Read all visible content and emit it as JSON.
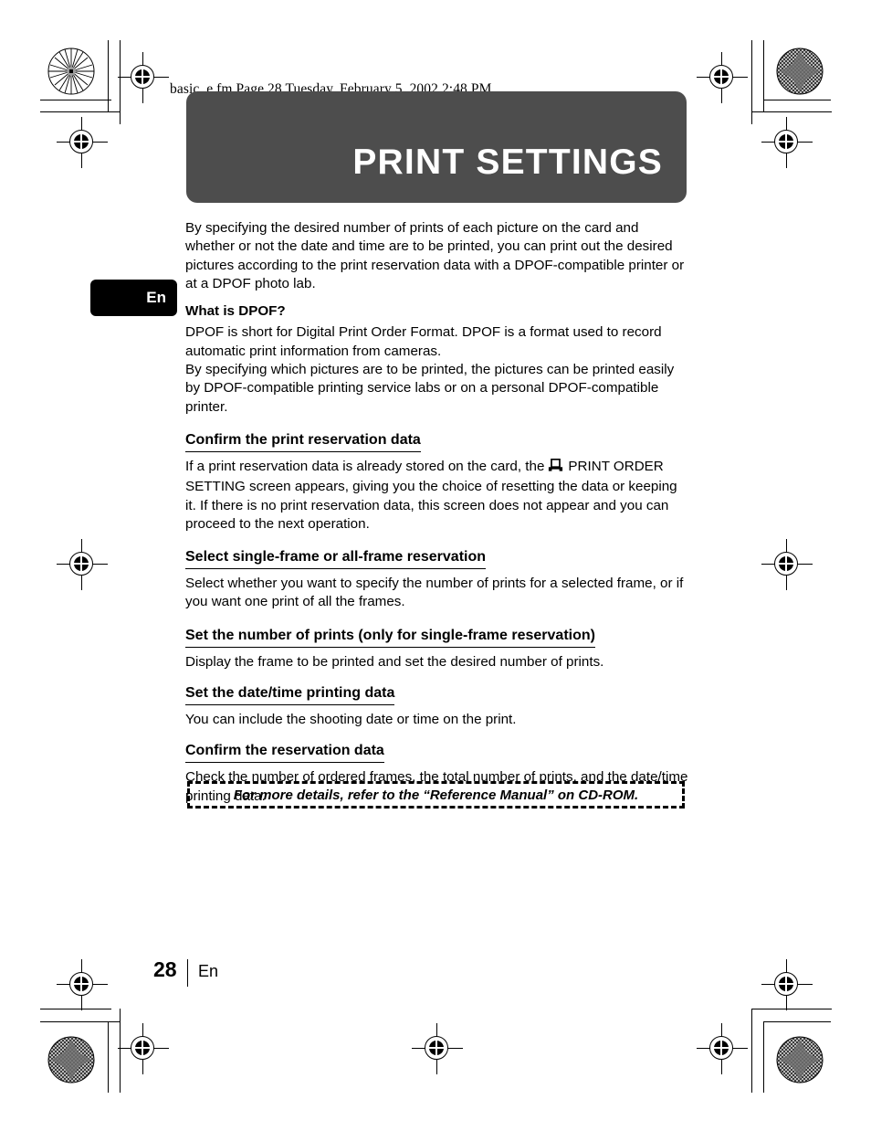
{
  "file_header": "basic_e.fm  Page 28  Tuesday, February 5, 2002  2:48 PM",
  "banner": {
    "title": "PRINT SETTINGS",
    "background_color": "#4d4d4d",
    "text_color": "#ffffff"
  },
  "language_tab": {
    "label": "En",
    "background_color": "#000000",
    "text_color": "#ffffff"
  },
  "content": {
    "intro": "By specifying the desired number of prints of each picture on the card and whether or not the date and time are to be printed, you can print out the desired pictures according to the print reservation data with a DPOF-compatible printer or at a DPOF photo lab.",
    "dpof_subhead": "What is DPOF?",
    "dpof_para_1": "DPOF is short for Digital Print Order Format. DPOF is a format used to record automatic print information from cameras.",
    "dpof_para_2": "By specifying which pictures are to be printed, the pictures can be printed easily by DPOF-compatible printing service labs or on a personal DPOF-compatible printer.",
    "sections": [
      {
        "heading": "Confirm the print reservation data",
        "body_before_icon": "If a print reservation data is already stored on the card, the",
        "icon": "printer-icon",
        "body_after_icon": "PRINT ORDER SETTING screen appears, giving you the choice of resetting the data or keeping it. If there is no print reservation data, this screen does not appear and you can proceed to the next operation."
      },
      {
        "heading": "Select single-frame or all-frame reservation",
        "body": "Select whether you want to specify the number of prints for a selected frame, or if you want one print of all the frames."
      },
      {
        "heading": "Set the number of prints (only for single-frame reservation)",
        "body": "Display the frame to be printed and set the desired number of prints."
      },
      {
        "heading": "Set the date/time printing data",
        "body": "You can include the shooting date or time on the print."
      },
      {
        "heading": "Confirm the reservation data",
        "body": "Check the number of ordered frames, the total number of prints, and the date/time printing data."
      }
    ]
  },
  "note_box": {
    "text": "For more details, refer to the “Reference Manual” on CD-ROM."
  },
  "footer": {
    "page_number": "28",
    "language": "En"
  }
}
